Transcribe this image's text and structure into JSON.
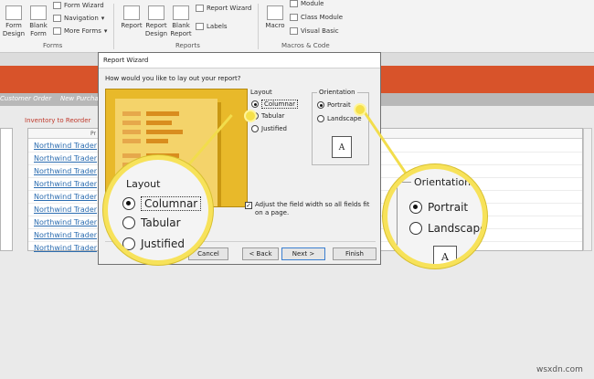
{
  "ribbon": {
    "forms_group": {
      "form_design": "Form\nDesign",
      "blank_form": "Blank\nForm",
      "form_wizard": "Form Wizard",
      "navigation": "Navigation",
      "more_forms": "More Forms",
      "label": "Forms"
    },
    "reports_group": {
      "report": "Report",
      "report_design": "Report\nDesign",
      "blank_report": "Blank\nReport",
      "report_wizard": "Report Wizard",
      "labels": "Labels",
      "label": "Reports"
    },
    "macros_group": {
      "macro": "Macro",
      "module": "Module",
      "class_module": "Class Module",
      "visual_basic": "Visual Basic",
      "label": "Macros & Code"
    }
  },
  "tabs": [
    "Customer Order",
    "New Purchase"
  ],
  "sheet": {
    "title": "Inventory to Reorder",
    "column_header": "Pr",
    "rows": [
      "Northwind Trader",
      "Northwind Trader",
      "Northwind Trader",
      "Northwind Trader",
      "Northwind Trader",
      "Northwind Trader",
      "Northwind Trader",
      "Northwind Trader",
      "Northwind Trader"
    ]
  },
  "dialog": {
    "title": "Report Wizard",
    "question": "How would you like to lay out your report?",
    "layout": {
      "label": "Layout",
      "options": [
        "Columnar",
        "Tabular",
        "Justified"
      ],
      "selected": "Columnar"
    },
    "orientation": {
      "label": "Orientation",
      "options": [
        "Portrait",
        "Landscape"
      ],
      "selected": "Portrait",
      "icon_letter": "A"
    },
    "adjust_checkbox": {
      "label": "Adjust the field width so all fields fit on a page.",
      "checked": true
    },
    "buttons": {
      "cancel": "Cancel",
      "back": "< Back",
      "next": "Next >",
      "finish": "Finish"
    }
  },
  "zoom_layout": {
    "label": "Layout",
    "options": [
      "Columnar",
      "Tabular",
      "Justified"
    ],
    "selected": "Columnar"
  },
  "zoom_orientation": {
    "label": "Orientation",
    "options": [
      "Portrait",
      "Landscape"
    ],
    "selected": "Portrait",
    "icon_letter": "A"
  },
  "watermark": "wsxdn.com",
  "colors": {
    "accent_orange": "#d8532a",
    "highlight_yellow": "#f7e25a",
    "link_blue": "#2b6cb0"
  }
}
